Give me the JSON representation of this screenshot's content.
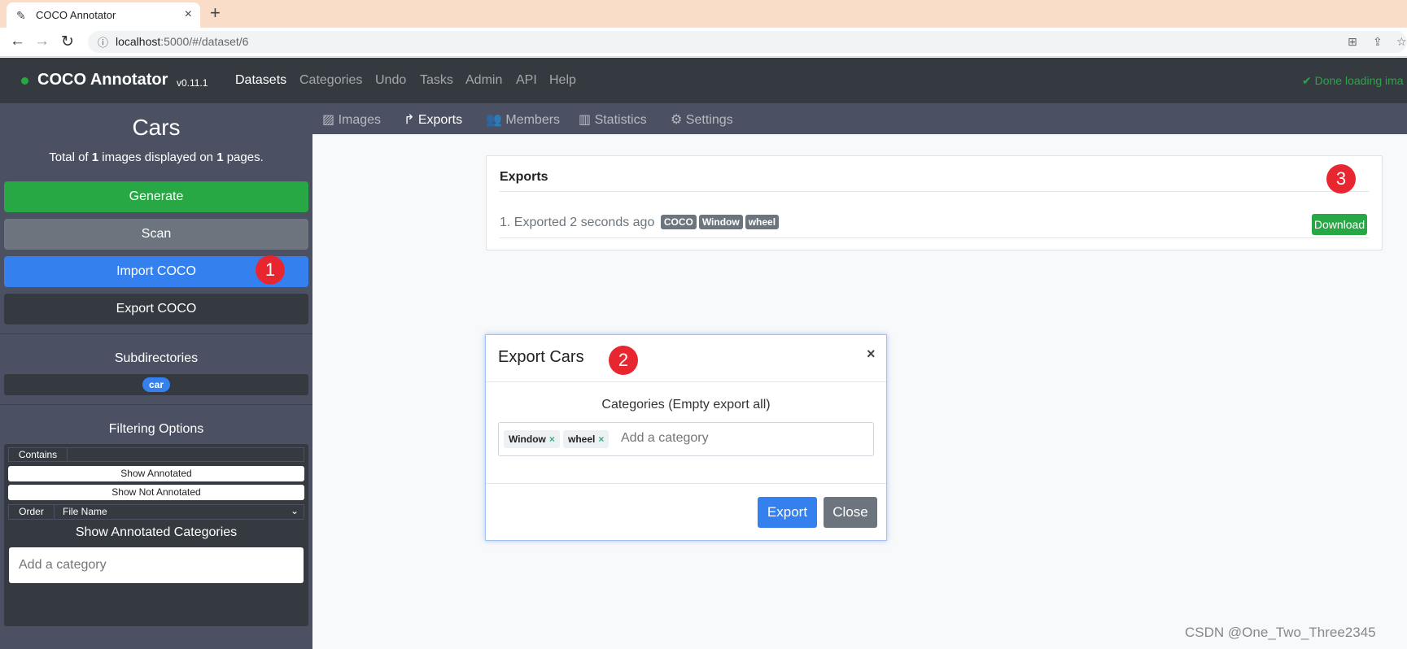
{
  "browser": {
    "tab_title": "COCO Annotator",
    "tab_close": "×",
    "new_tab": "+",
    "url_host": "localhost",
    "url_rest": ":5000/#/dataset/6"
  },
  "navbar": {
    "brand": "COCO Annotator",
    "version": "v0.11.1",
    "items": [
      "Datasets",
      "Categories",
      "Undo",
      "Tasks",
      "Admin",
      "API",
      "Help"
    ],
    "status": "Done loading ima"
  },
  "sidebar": {
    "title": "Cars",
    "total_prefix": "Total of ",
    "total_images": "1",
    "total_middle": " images displayed on ",
    "total_pages": "1",
    "total_suffix": " pages.",
    "generate": "Generate",
    "scan": "Scan",
    "import": "Import COCO",
    "export": "Export COCO",
    "subdirectories_title": "Subdirectories",
    "subdirectory": "car",
    "filtering_title": "Filtering Options",
    "contains_label": "Contains",
    "show_annotated": "Show Annotated",
    "show_not_annotated": "Show Not Annotated",
    "order_label": "Order",
    "order_value": "File Name",
    "annotated_categories_title": "Show Annotated Categories",
    "category_placeholder": "Add a category"
  },
  "subnav": {
    "items": [
      "Images",
      "Exports",
      "Members",
      "Statistics",
      "Settings"
    ],
    "active": "Exports"
  },
  "exports_card": {
    "title": "Exports",
    "entry_text": "1. Exported 2 seconds ago",
    "badges": [
      "COCO",
      "Window",
      "wheel"
    ],
    "download": "Download"
  },
  "modal": {
    "title": "Export Cars",
    "close": "×",
    "categories_label": "Categories (Empty export all)",
    "tags": [
      "Window",
      "wheel"
    ],
    "tag_remove": "×",
    "input_placeholder": "Add a category",
    "export_button": "Export",
    "close_button": "Close"
  },
  "markers": [
    "1",
    "2",
    "3"
  ],
  "watermark": "CSDN @One_Two_Three2345",
  "colors": {
    "navbar": "#343a40",
    "sidebar": "#4b5162",
    "success": "#28a745",
    "primary": "#3580ef",
    "secondary": "#6c757d",
    "marker": "#e8262f"
  }
}
